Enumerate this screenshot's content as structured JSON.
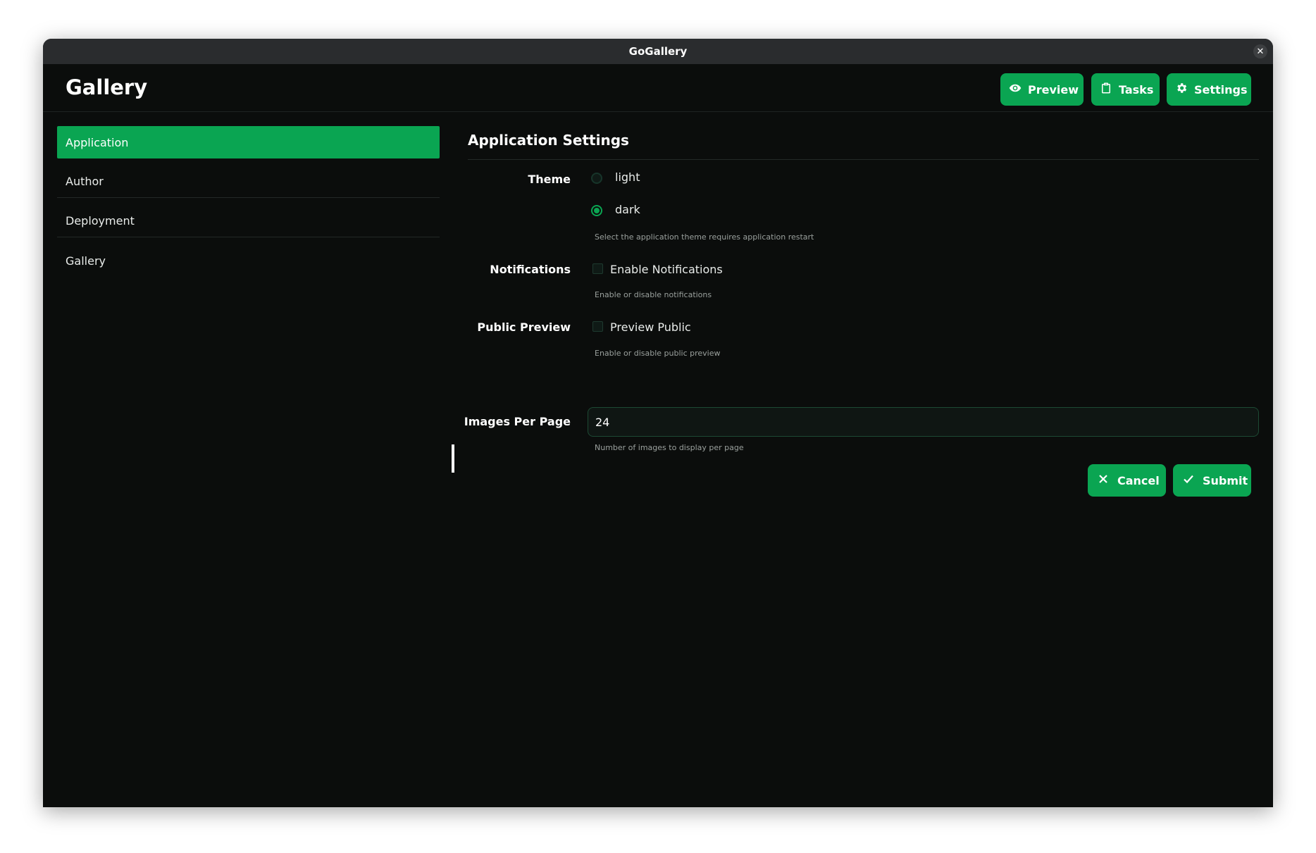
{
  "window": {
    "title": "GoGallery",
    "close_label": "✕"
  },
  "header": {
    "app_title": "Gallery",
    "buttons": [
      {
        "label": "Preview",
        "icon": "eye-icon"
      },
      {
        "label": "Tasks",
        "icon": "clipboard-icon"
      },
      {
        "label": "Settings",
        "icon": "gear-icon"
      }
    ]
  },
  "sidebar": {
    "items": [
      {
        "label": "Application",
        "active": true
      },
      {
        "label": "Author",
        "active": false
      },
      {
        "label": "Deployment",
        "active": false
      },
      {
        "label": "Gallery",
        "active": false
      }
    ]
  },
  "main": {
    "section_title": "Application Settings",
    "theme": {
      "label": "Theme",
      "options": [
        {
          "label": "light",
          "checked": false
        },
        {
          "label": "dark",
          "checked": true
        }
      ],
      "help": "Select the application theme requires application restart"
    },
    "notifications": {
      "label": "Notifications",
      "checkbox_label": "Enable Notifications",
      "checked": false,
      "help": "Enable or disable notifications"
    },
    "public_preview": {
      "label": "Public Preview",
      "checkbox_label": "Preview Public",
      "checked": false,
      "help": "Enable or disable public preview"
    },
    "images_per_page": {
      "label": "Images Per Page",
      "value": "24",
      "help": "Number of images to display per page"
    },
    "actions": {
      "cancel_label": "Cancel",
      "submit_label": "Submit"
    }
  },
  "colors": {
    "accent": "#0aa552",
    "background": "#0b0d0c",
    "titlebar": "#2a2c2e"
  }
}
